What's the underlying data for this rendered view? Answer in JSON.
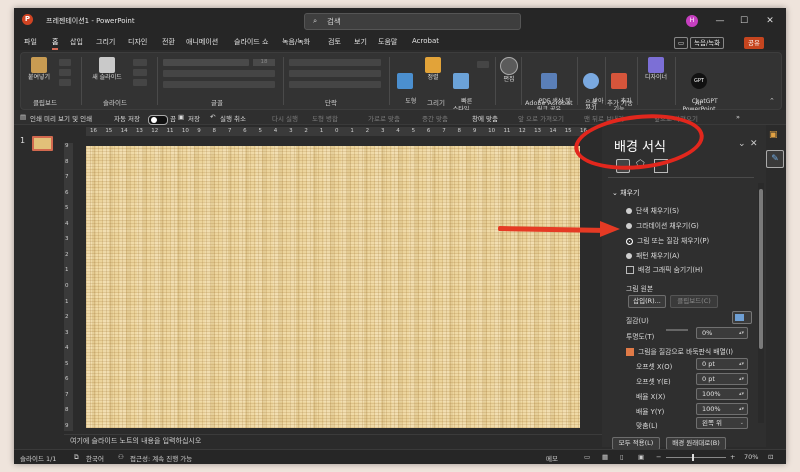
{
  "window": {
    "document_title": "프레젠테이션1 - PowerPoint",
    "search_placeholder": "검색",
    "avatar_initial": "H",
    "minimize": "—",
    "maximize": "☐",
    "close": "✕"
  },
  "menu": {
    "items": [
      "파일",
      "홈",
      "삽입",
      "그리기",
      "디자인",
      "전환",
      "애니메이션",
      "슬라이드 쇼",
      "녹음/녹화",
      "검토",
      "보기",
      "도움말",
      "Acrobat"
    ],
    "active_index": 1,
    "record_label": "녹음/녹화",
    "share_label": "공유"
  },
  "ribbon": {
    "clipboard": {
      "paste": "붙여넣기",
      "label": "클립보드"
    },
    "slides": {
      "new_slide": "새 슬라이드",
      "label": "슬라이드"
    },
    "font": {
      "size": "18",
      "label": "글꼴"
    },
    "paragraph": {
      "label": "단락"
    },
    "drawing": {
      "shape": "도형",
      "arrange": "정렬",
      "quick_styles": "빠른\n스타일",
      "label": "그리기"
    },
    "editing": {
      "edit": "편집"
    },
    "acrobat": {
      "create_pdf": "PDF 생성 및\n링크 공유",
      "label": "Adobe Acrobat"
    },
    "voice": {
      "dictate": "받아\n쓰기",
      "label": "음성"
    },
    "addins": {
      "addins": "추가\n기능",
      "label": "추가 기능"
    },
    "designer": {
      "designer": "디자이너"
    },
    "chatgpt": {
      "name": "ChatGPT\nPowerPoint",
      "badge": "GPT",
      "label": "AI"
    }
  },
  "qat": {
    "items": [
      "인쇄 미리 보기 및 인쇄",
      "자동 저장",
      "끔",
      "저장",
      "실행 취소",
      "다시 실행",
      "도형 병합",
      "가로로 맞춤",
      "중간 맞춤",
      "창에 맞춤",
      "앞 으로 가져오기",
      "맨 뒤로 보내기",
      "앞으로 가져오기"
    ]
  },
  "thumbs": {
    "number": "1"
  },
  "rulers": {
    "horizontal": [
      "16",
      "15",
      "14",
      "13",
      "12",
      "11",
      "10",
      "9",
      "8",
      "7",
      "6",
      "5",
      "4",
      "3",
      "2",
      "1",
      "0",
      "1",
      "2",
      "3",
      "4",
      "5",
      "6",
      "7",
      "8",
      "9",
      "10",
      "11",
      "12",
      "13",
      "14",
      "15",
      "16"
    ],
    "vertical": [
      "9",
      "8",
      "7",
      "6",
      "5",
      "4",
      "3",
      "2",
      "1",
      "0",
      "1",
      "2",
      "3",
      "4",
      "5",
      "6",
      "7",
      "8",
      "9"
    ]
  },
  "notes": {
    "placeholder": "여기에 슬라이드 노트의 내용을 입력하십시오"
  },
  "status": {
    "slide": "슬라이드 1/1",
    "language": "한국어",
    "accessibility": "접근성: 계속 진행 가능",
    "notes": "메모",
    "zoom": "70%"
  },
  "pane": {
    "title": "배경 서식",
    "section": "채우기",
    "fills": [
      "단색 채우기(S)",
      "그라데이션 채우기(G)",
      "그림 또는 질감 채우기(P)",
      "패턴 채우기(A)"
    ],
    "selected_fill_index": 2,
    "hide_graphics": "배경 그래픽 숨기기(H)",
    "picture_source": "그림 원본",
    "insert": "삽입(R)...",
    "clipboard": "클립보드(C)",
    "texture": "질감(U)",
    "transparency": "투명도(T)",
    "transparency_value": "0%",
    "tile": "그림을 질감으로 바둑판식 배열(I)",
    "offset_x": "오프셋 X(O)",
    "offset_x_value": "0 pt",
    "offset_y": "오프셋 Y(E)",
    "offset_y_value": "0 pt",
    "scale_x": "배율 X(X)",
    "scale_x_value": "100%",
    "scale_y": "배율 Y(Y)",
    "scale_y_value": "100%",
    "alignment": "맞춤(L)",
    "alignment_value": "왼쪽 위",
    "apply_all": "모두 적용(L)",
    "reset": "배경 원래대로(B)"
  },
  "colors": {
    "accent": "#d66b55",
    "share": "#c5451f",
    "annotation": "#e2271d",
    "texture_base": "#ecd49c"
  }
}
